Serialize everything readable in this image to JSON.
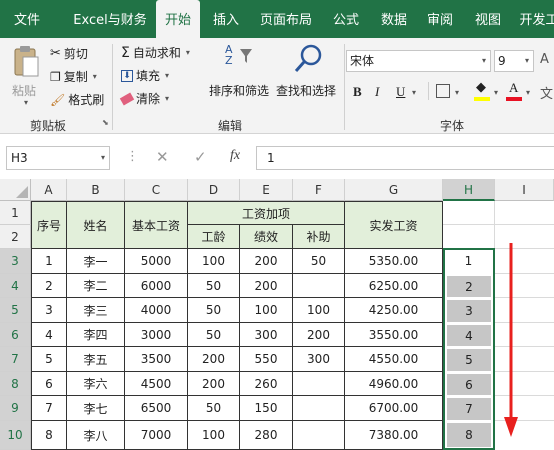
{
  "tabs": [
    "文件",
    "Excel与财务",
    "开始",
    "插入",
    "页面布局",
    "公式",
    "数据",
    "审阅",
    "视图",
    "开发工"
  ],
  "ribbon": {
    "paste": "粘贴",
    "cut": "剪切",
    "copy": "复制",
    "format_painter": "格式刷",
    "clipboard_group": "剪贴板",
    "autosum": "自动求和",
    "fill": "填充",
    "clear": "清除",
    "sort_filter": "排序和筛选",
    "find_select": "查找和选择",
    "editing_group": "编辑",
    "font_name": "宋体",
    "font_size": "9",
    "bold": "B",
    "italic": "I",
    "underline": "U",
    "font_group": "字体",
    "font_color_accent": "#e81123",
    "fill_color_accent": "#ffff00"
  },
  "formula_bar": {
    "name_box": "H3",
    "fx": "fx",
    "value": "1"
  },
  "columns": [
    "A",
    "B",
    "C",
    "D",
    "E",
    "F",
    "G",
    "H",
    "I"
  ],
  "rows": [
    "1",
    "2",
    "3",
    "4",
    "5",
    "6",
    "7",
    "8",
    "9",
    "10"
  ],
  "table": {
    "h_seq": "序号",
    "h_name": "姓名",
    "h_base": "基本工资",
    "h_extra": "工资加项",
    "h_age": "工龄",
    "h_perf": "绩效",
    "h_subsidy": "补助",
    "h_total": "实发工资",
    "rows": [
      [
        "1",
        "李一",
        "5000",
        "100",
        "200",
        "50",
        "5350.00",
        "1"
      ],
      [
        "2",
        "李二",
        "6000",
        "50",
        "200",
        "",
        "6250.00",
        "2"
      ],
      [
        "3",
        "李三",
        "4000",
        "50",
        "100",
        "100",
        "4250.00",
        "3"
      ],
      [
        "4",
        "李四",
        "3000",
        "50",
        "300",
        "200",
        "3550.00",
        "4"
      ],
      [
        "5",
        "李五",
        "3500",
        "200",
        "550",
        "300",
        "4550.00",
        "5"
      ],
      [
        "6",
        "李六",
        "4500",
        "200",
        "260",
        "",
        "4960.00",
        "6"
      ],
      [
        "7",
        "李七",
        "6500",
        "50",
        "150",
        "",
        "6700.00",
        "7"
      ],
      [
        "8",
        "李八",
        "7000",
        "100",
        "280",
        "",
        "7380.00",
        "8"
      ]
    ]
  },
  "arrow_color": "#e8201e",
  "accent": "#217346"
}
